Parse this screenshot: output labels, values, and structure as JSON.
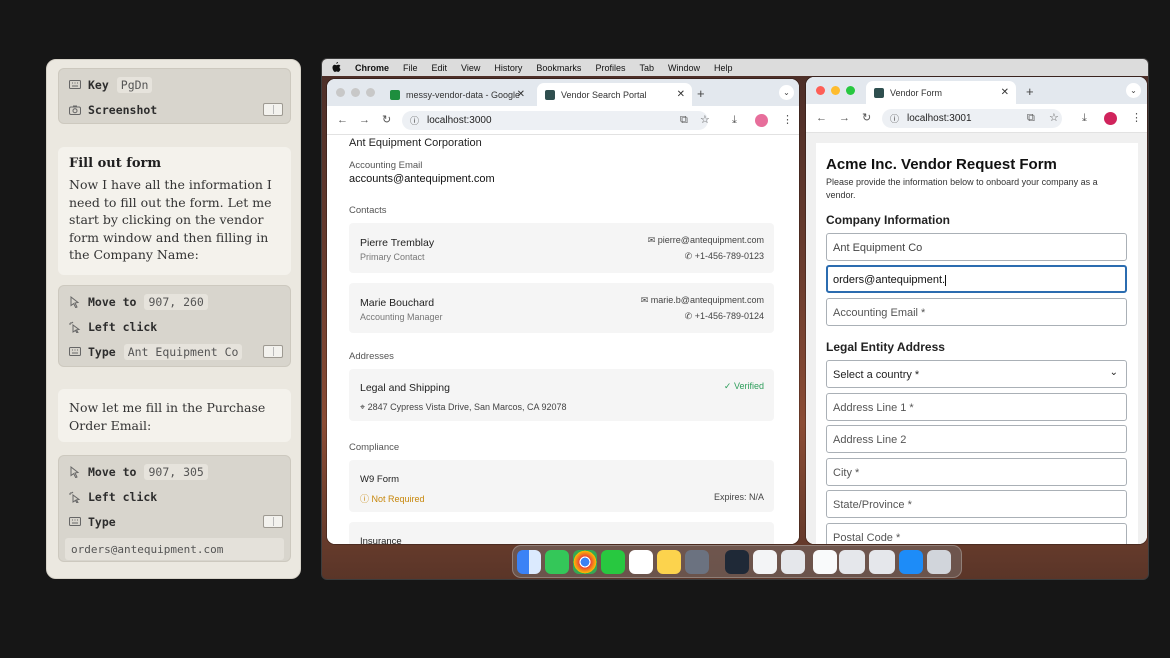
{
  "agent_panel": {
    "step_group_1": [
      {
        "icon": "keyboard-icon",
        "action": "Key",
        "arg": "PgDn"
      },
      {
        "icon": "camera-icon",
        "action": "Screenshot",
        "arg": ""
      }
    ],
    "note_1": {
      "title": "Fill out form",
      "text": "Now I have all the information I need to fill out the form. Let me start by clicking on the vendor form window and then filling in the Company Name:"
    },
    "step_group_2": [
      {
        "icon": "cursor-icon",
        "action": "Move to",
        "arg": "907, 260"
      },
      {
        "icon": "click-icon",
        "action": "Left click",
        "arg": ""
      },
      {
        "icon": "keyboard-icon",
        "action": "Type",
        "arg": "Ant Equipment Co"
      }
    ],
    "note_2": {
      "text": "Now let me fill in the Purchase Order Email:"
    },
    "step_group_3": [
      {
        "icon": "cursor-icon",
        "action": "Move to",
        "arg": "907, 305"
      },
      {
        "icon": "click-icon",
        "action": "Left click",
        "arg": ""
      },
      {
        "icon": "keyboard-icon",
        "action": "Type",
        "arg": ""
      }
    ],
    "typed_text": "orders@antequipment.com"
  },
  "menubar": {
    "apple": "",
    "items": [
      "Chrome",
      "File",
      "Edit",
      "View",
      "History",
      "Bookmarks",
      "Profiles",
      "Tab",
      "Window",
      "Help"
    ]
  },
  "left_browser": {
    "tabs": [
      {
        "title": "messy-vendor-data - Google",
        "favicon_color": "#1e8e3e"
      },
      {
        "title": "Vendor Search Portal",
        "favicon_color": "#2f4f4f"
      }
    ],
    "url": "localhost:3000",
    "page": {
      "company": "Ant Equipment Corporation",
      "accounting_email_label": "Accounting Email",
      "accounting_email": "accounts@antequipment.com",
      "contacts_heading": "Contacts",
      "contacts": [
        {
          "name": "Pierre Tremblay",
          "role": "Primary Contact",
          "email": "pierre@antequipment.com",
          "phone": "+1-456-789-0123"
        },
        {
          "name": "Marie Bouchard",
          "role": "Accounting Manager",
          "email": "marie.b@antequipment.com",
          "phone": "+1-456-789-0124"
        }
      ],
      "addresses_heading": "Addresses",
      "address": {
        "title": "Legal and Shipping",
        "status": "Verified",
        "line": "2847 Cypress Vista Drive, San Marcos, CA 92078"
      },
      "compliance_heading": "Compliance",
      "w9": {
        "title": "W9 Form",
        "status": "Not Required",
        "expires": "Expires: N/A"
      },
      "insurance_title": "Insurance"
    }
  },
  "right_browser": {
    "tab_title": "Vendor Form",
    "url": "localhost:3001",
    "form": {
      "title": "Acme Inc. Vendor Request Form",
      "subtitle": "Please provide the information below to onboard your company as a vendor.",
      "company_heading": "Company Information",
      "company_name_value": "Ant Equipment Co",
      "po_email_value": "orders@antequipment.",
      "accounting_email_placeholder": "Accounting Email *",
      "address_heading": "Legal Entity Address",
      "country_placeholder": "Select a country *",
      "address1_placeholder": "Address Line 1 *",
      "address2_placeholder": "Address Line 2",
      "city_placeholder": "City *",
      "state_placeholder": "State/Province *",
      "postal_placeholder": "Postal Code *"
    }
  },
  "colors": {
    "accent": "#2b6cb0",
    "verified": "#2e9e5b",
    "warning": "#c7870b",
    "avatar": "#d0245c"
  }
}
